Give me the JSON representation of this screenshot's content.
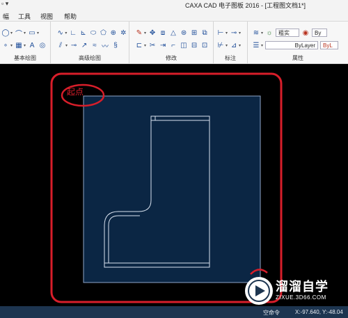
{
  "title_bar": {
    "quick_access": "▫ ▾",
    "title": "CAXA CAD 电子图板 2016 - [工程图文档1*]"
  },
  "menu": {
    "items": [
      "幅",
      "工具",
      "视图",
      "帮助"
    ]
  },
  "ribbon": {
    "groups": [
      {
        "label": "基本绘图"
      },
      {
        "label": "高级绘图"
      },
      {
        "label": "修改"
      },
      {
        "label": "标注"
      },
      {
        "label": "属性"
      }
    ],
    "properties": {
      "layer_value": "粗实",
      "linetype_value": "ByLayer",
      "color_value": "ByLayer",
      "by_label_top": "By",
      "by_label_bottom": "ByL"
    }
  },
  "canvas": {
    "annotation_label": "起点",
    "colors": {
      "background": "#000000",
      "paper": "#0b2644",
      "paper_border": "#8fa6c8",
      "drawing_line": "#d9e2ef",
      "highlight": "#d81e2a"
    }
  },
  "status_bar": {
    "command": "空命令",
    "coords": "X:-97.640, Y:-48.04"
  },
  "watermark": {
    "text": "溜溜自学",
    "sub": "ZIXUE.3D66.COM"
  }
}
